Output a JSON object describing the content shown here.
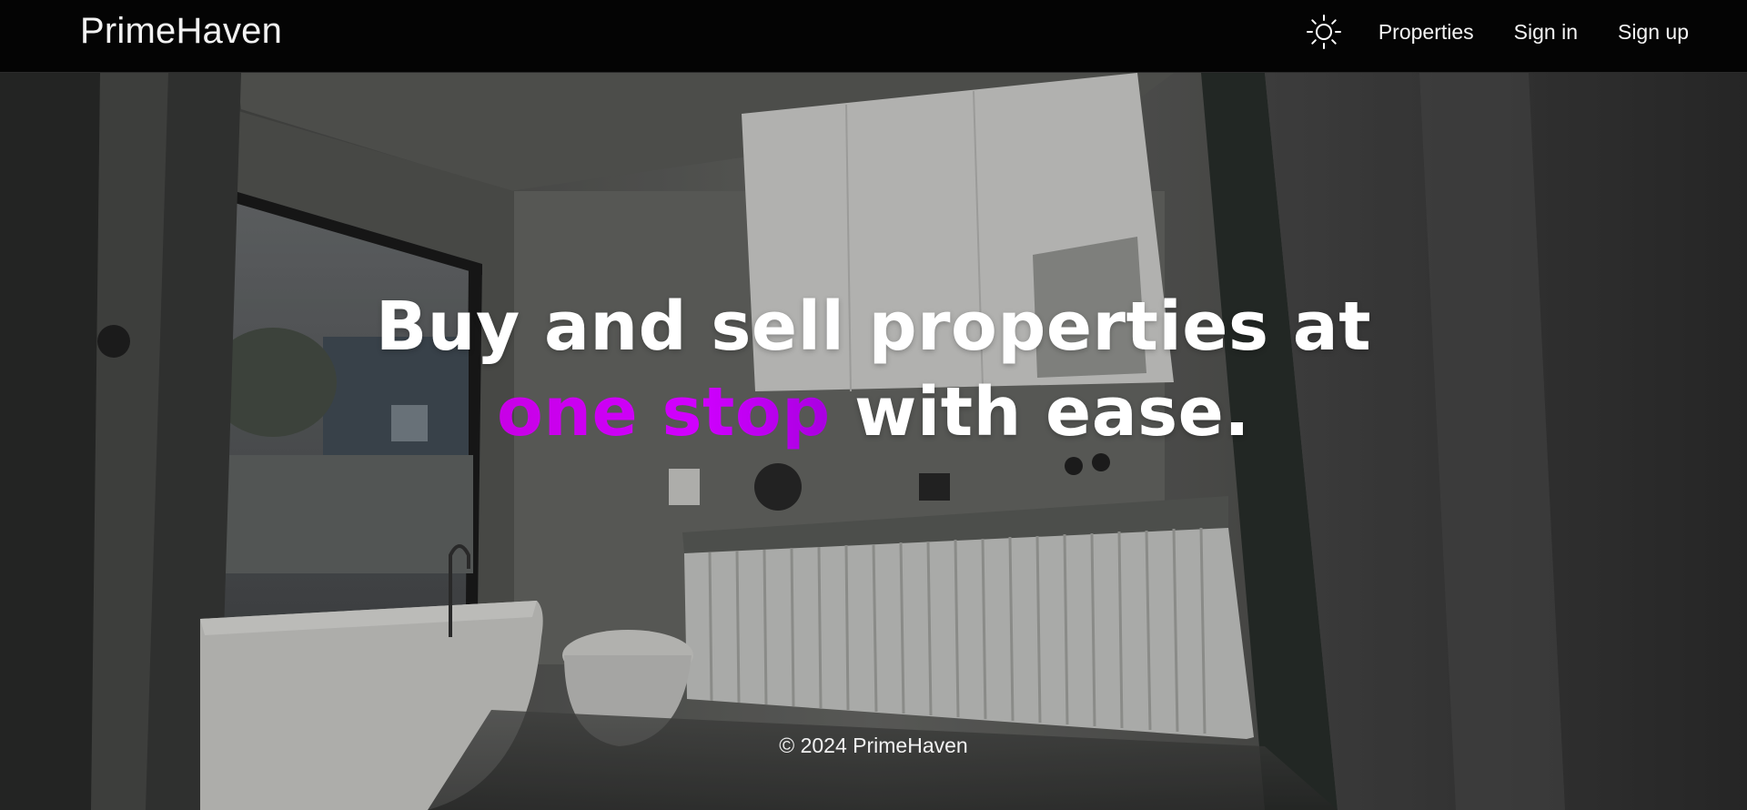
{
  "navbar": {
    "brand": "PrimeHaven",
    "theme_icon": "sun-icon",
    "links": {
      "properties": "Properties",
      "sign_in": "Sign in",
      "sign_up": "Sign up"
    }
  },
  "hero": {
    "headline_line1": "Buy and sell properties at",
    "headline_accent": "one stop",
    "headline_rest": " with ease.",
    "accent_color": "#cc00f5",
    "background_image": "dim bathroom interior"
  },
  "footer": {
    "copyright": "© 2024 PrimeHaven"
  },
  "colors": {
    "navbar_bg": "#040404",
    "text": "#ffffff"
  }
}
